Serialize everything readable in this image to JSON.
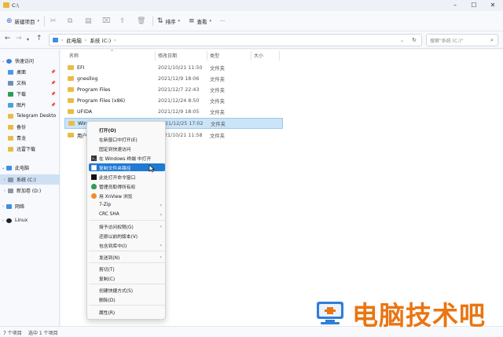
{
  "window": {
    "title": "C:\\"
  },
  "toolbar": {
    "new_label": "新建项目",
    "sort_label": "排序",
    "view_label": "查看",
    "more_label": "···"
  },
  "address": {
    "crumbs": [
      "此电脑",
      "系统 (C:)"
    ],
    "search_placeholder": "搜索\"系统 (C:)\""
  },
  "sidebar": {
    "items": [
      {
        "label": "快速访问"
      },
      {
        "label": "桌面"
      },
      {
        "label": "文档"
      },
      {
        "label": "下载"
      },
      {
        "label": "图片"
      },
      {
        "label": "Telegram Deskto"
      },
      {
        "label": "备份"
      },
      {
        "label": "青龙"
      },
      {
        "label": "迅雷下载"
      },
      {
        "label": "此电脑"
      },
      {
        "label": "系统 (C:)"
      },
      {
        "label": "新加卷 (D:)"
      },
      {
        "label": "网络"
      },
      {
        "label": "Linux"
      }
    ]
  },
  "columns": {
    "name": "名称",
    "date": "修改日期",
    "type": "类型",
    "size": "大小"
  },
  "files": [
    {
      "name": "EFI",
      "date": "2021/10/21 11:50",
      "type": "文件夹"
    },
    {
      "name": "gnesllog",
      "date": "2021/12/9 18:06",
      "type": "文件夹"
    },
    {
      "name": "Program Files",
      "date": "2021/12/7 22:43",
      "type": "文件夹"
    },
    {
      "name": "Program Files (x86)",
      "date": "2021/12/24 8:50",
      "type": "文件夹"
    },
    {
      "name": "UFIDA",
      "date": "2021/12/9 18:05",
      "type": "文件夹"
    },
    {
      "name": "Windows",
      "date": "2021/12/25 17:02",
      "type": "文件夹"
    },
    {
      "name": "用户",
      "date": "2021/10/21 11:58",
      "type": "文件夹"
    }
  ],
  "context_menu": {
    "items": [
      {
        "label": "打开(O)",
        "bold": true
      },
      {
        "label": "在新窗口中打开(E)"
      },
      {
        "label": "固定到快速访问"
      },
      {
        "label": "在 Windows 终端 中打开",
        "icon": "terminal-icon"
      },
      {
        "label": "复制文件夹路径",
        "icon": "copy-path-icon",
        "highlight": true
      },
      {
        "label": "此处打开命令窗口",
        "icon": "cmd-icon"
      },
      {
        "label": "管理员取得所有权",
        "icon": "shield-icon"
      },
      {
        "label": "用 XnView 浏览",
        "icon": "xnview-icon"
      },
      {
        "label": "7-Zip",
        "submenu": true
      },
      {
        "label": "CRC SHA",
        "submenu": true
      },
      {
        "label": "授予访问权限(G)",
        "submenu": true
      },
      {
        "label": "还原以前的版本(V)"
      },
      {
        "label": "包含到库中(I)",
        "submenu": true
      },
      {
        "label": "发送到(N)",
        "submenu": true
      },
      {
        "label": "剪切(T)"
      },
      {
        "label": "复制(C)"
      },
      {
        "label": "创建快捷方式(S)"
      },
      {
        "label": "删除(D)"
      },
      {
        "label": "属性(R)"
      }
    ]
  },
  "status": {
    "count": "7 个项目",
    "selected": "选中 1 个项目"
  },
  "watermark": {
    "text": "电脑技术吧"
  },
  "colors": {
    "accent": "#1f7ad4",
    "folder": "#eabc46",
    "watermark": "#ea7512"
  }
}
